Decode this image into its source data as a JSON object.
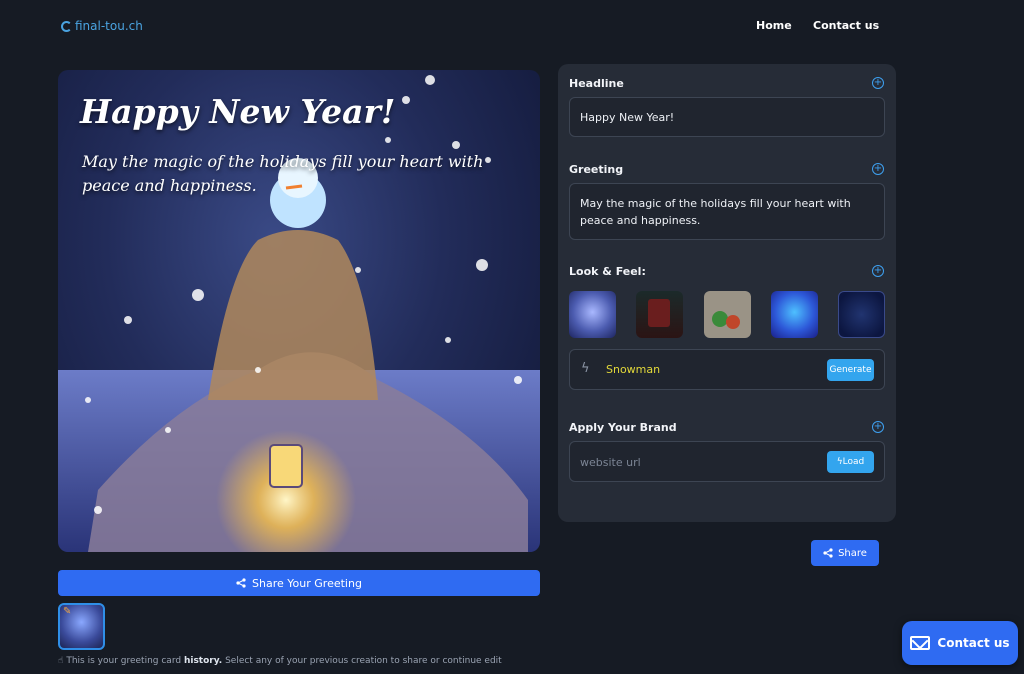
{
  "header": {
    "logo_text": "final-tou.ch",
    "nav": [
      {
        "label": "Home"
      },
      {
        "label": "Contact us"
      }
    ]
  },
  "preview": {
    "headline": "Happy New Year!",
    "greeting": "May the magic of the holidays fill your heart with peace and happiness."
  },
  "share_greeting_label": "Share Your Greeting",
  "history_note": {
    "prefix": "This is your greeting card",
    "bold": "history.",
    "suffix": "Select any of your previous creation to share or continue edit"
  },
  "editor": {
    "headline_label": "Headline",
    "headline_value": "Happy New Year!",
    "greeting_label": "Greeting",
    "greeting_value": "May the magic of the holidays fill your heart with peace and happiness.",
    "look_label": "Look & Feel:",
    "style_value": "Snowman",
    "generate_label": "Generate",
    "brand_label": "Apply Your Brand",
    "brand_placeholder": "website url",
    "load_label": "Load"
  },
  "share_label": "Share",
  "contact_float_label": "Contact us",
  "colors": {
    "accent": "#2f6bf2",
    "secondary_button": "#33a5ee",
    "style_text": "#e2d83a"
  }
}
